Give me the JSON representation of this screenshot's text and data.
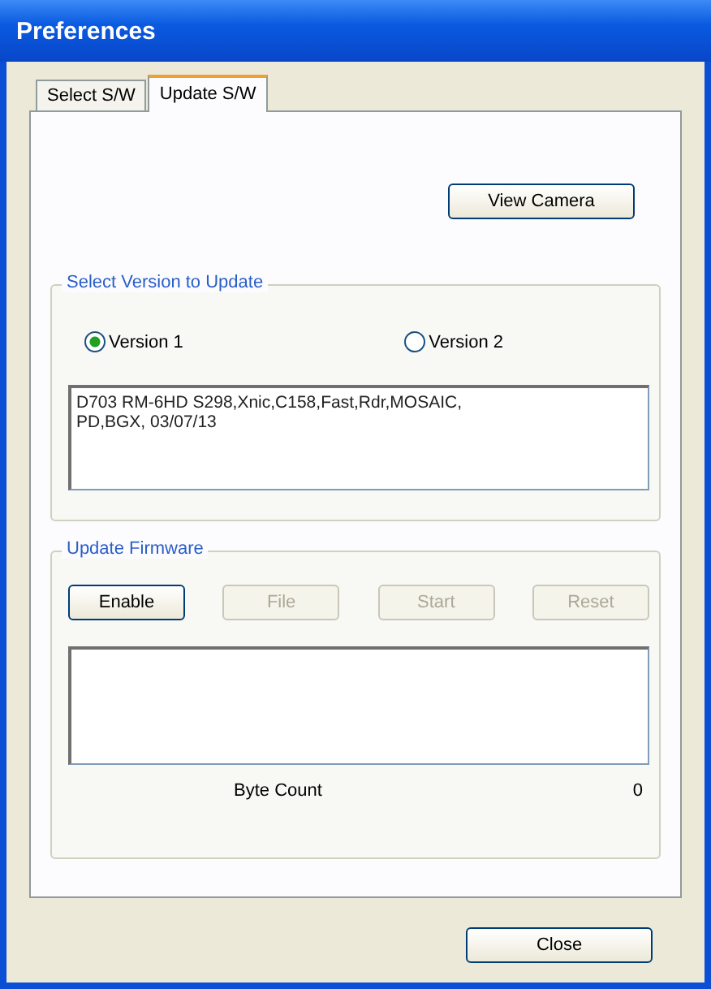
{
  "window": {
    "title": "Preferences"
  },
  "tabs": [
    {
      "label": "Select S/W",
      "selected": false
    },
    {
      "label": "Update S/W",
      "selected": true
    }
  ],
  "view_camera_button": {
    "label": "View Camera",
    "disabled": false
  },
  "version_group": {
    "title": "Select Version to Update",
    "options": [
      {
        "label": "Version 1",
        "selected": true
      },
      {
        "label": "Version 2",
        "selected": false
      }
    ],
    "details": "D703 RM-6HD S298,Xnic,C158,Fast,Rdr,MOSAIC,\nPD,BGX, 03/07/13"
  },
  "firmware_group": {
    "title": "Update Firmware",
    "buttons": [
      {
        "label": "Enable",
        "disabled": false
      },
      {
        "label": "File",
        "disabled": true
      },
      {
        "label": "Start",
        "disabled": true
      },
      {
        "label": "Reset",
        "disabled": true
      }
    ],
    "byte_count_label": "Byte Count",
    "byte_count": "0"
  },
  "close_button": {
    "label": "Close",
    "disabled": false
  }
}
